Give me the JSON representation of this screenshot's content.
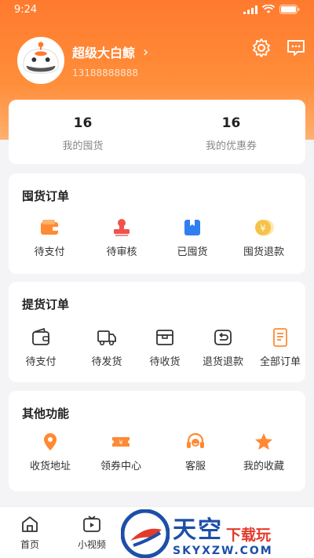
{
  "status": {
    "time": "9:24"
  },
  "profile": {
    "username": "超级大白鲸",
    "phone": "13188888888"
  },
  "stats": [
    {
      "value": "16",
      "label": "我的囤货"
    },
    {
      "value": "16",
      "label": "我的优惠券"
    }
  ],
  "hoard_orders": {
    "title": "囤货订单",
    "items": [
      {
        "label": "待支付",
        "icon": "wallet-icon"
      },
      {
        "label": "待审核",
        "icon": "stamp-icon"
      },
      {
        "label": "已囤货",
        "icon": "box-icon"
      },
      {
        "label": "囤货退款",
        "icon": "coin-refund-icon"
      }
    ]
  },
  "pickup_orders": {
    "title": "提货订单",
    "items": [
      {
        "label": "待支付",
        "icon": "wallet-icon"
      },
      {
        "label": "待发货",
        "icon": "truck-icon"
      },
      {
        "label": "待收货",
        "icon": "package-icon"
      },
      {
        "label": "退货退款",
        "icon": "return-icon"
      },
      {
        "label": "全部订单",
        "icon": "order-list-icon"
      }
    ]
  },
  "other_functions": {
    "title": "其他功能",
    "items": [
      {
        "label": "收货地址",
        "icon": "location-icon"
      },
      {
        "label": "领券中心",
        "icon": "coupon-icon"
      },
      {
        "label": "客服",
        "icon": "headset-icon"
      },
      {
        "label": "我的收藏",
        "icon": "star-icon"
      }
    ]
  },
  "tabbar": [
    {
      "label": "首页",
      "icon": "home-icon"
    },
    {
      "label": "小视频",
      "icon": "video-icon"
    }
  ],
  "watermark": {
    "brand": "天空",
    "sub": "下载玩",
    "url": "SKYXZW.COM"
  },
  "colors": {
    "accent": "#ff7a2e",
    "icon_orange": "#ff8a33",
    "icon_red": "#f0534e",
    "icon_blue": "#2f7ff0"
  }
}
